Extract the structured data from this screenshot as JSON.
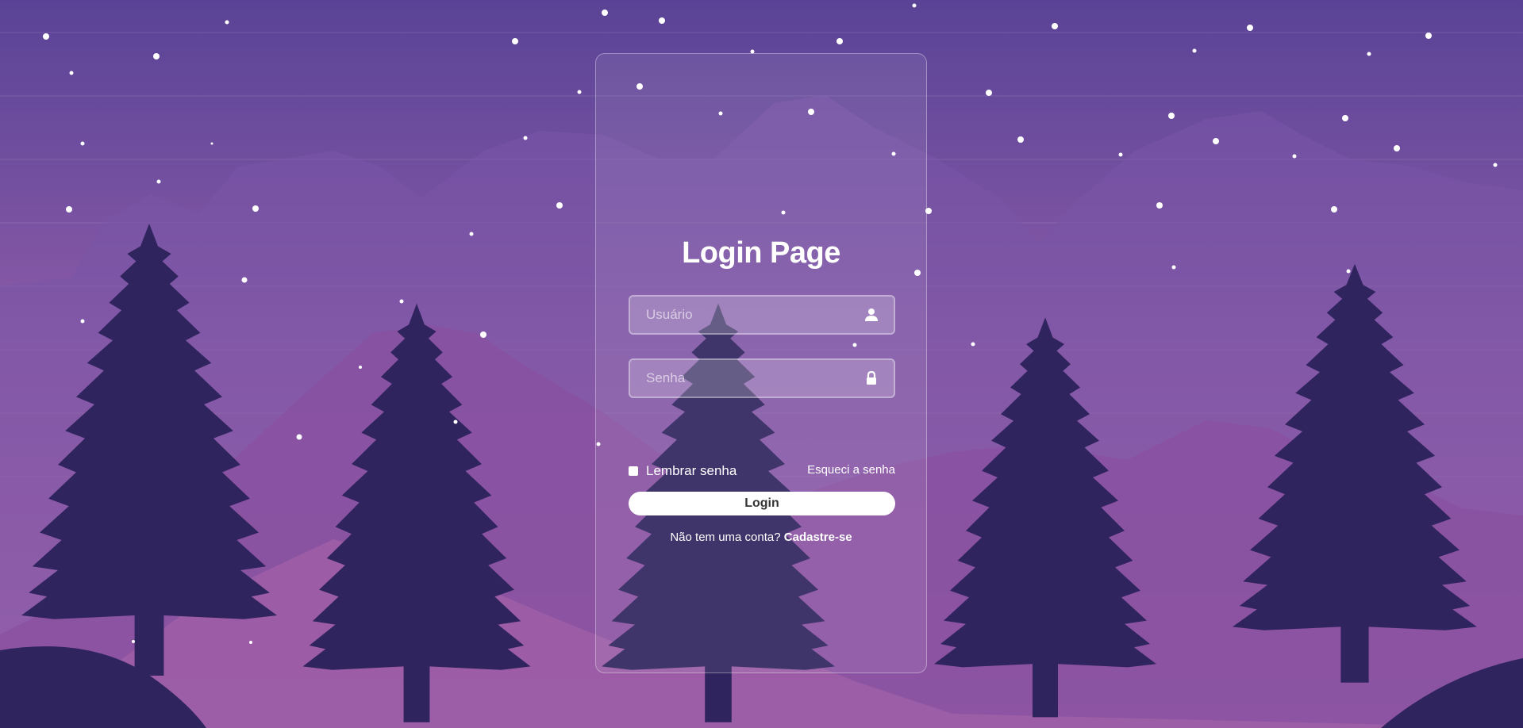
{
  "background": {
    "sky_top": "#5a4396",
    "sky_bottom": "#b06cac",
    "tree_color": "#30245e"
  },
  "login": {
    "title": "Login Page",
    "username_placeholder": "Usuário",
    "password_placeholder": "Senha",
    "user_icon": "user-icon",
    "lock_icon": "lock-icon",
    "remember_label": "Lembrar senha",
    "forgot_label": "Esqueci a senha",
    "submit_label": "Login",
    "register_prompt": "Não tem uma conta?",
    "register_link": "Cadastre-se"
  }
}
